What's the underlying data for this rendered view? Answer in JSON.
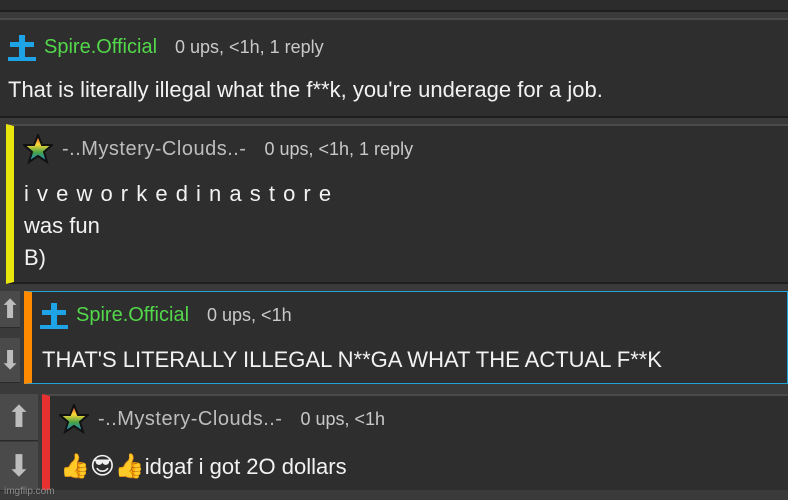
{
  "colors": {
    "username_green": "#52d84a",
    "thread_yellow": "#e8e60b",
    "thread_orange": "#ff8a00",
    "thread_red": "#e83030",
    "highlight_blue": "#1fa3d8"
  },
  "comments": [
    {
      "user": "Spire.Official",
      "meta": "0 ups, <1h, 1 reply",
      "text": "That is literally illegal what the f**k, you're underage for a job."
    },
    {
      "user": "-..Mystery-Clouds..-",
      "meta": "0 ups, <1h, 1 reply",
      "lines": [
        "i v e w o r k e d i n a s t o r e",
        "was fun",
        "B)"
      ]
    },
    {
      "user": "Spire.Official",
      "meta": "0 ups, <1h",
      "text": "THAT'S LITERALLY ILLEGAL N**GA WHAT THE ACTUAL F**K"
    },
    {
      "user": "-..Mystery-Clouds..-",
      "meta": "0 ups, <1h",
      "emoji": "👍😎👍",
      "text": "idgaf i got 2O dollars"
    }
  ],
  "icons": {
    "vote_up": "up-arrow-icon",
    "vote_down": "down-arrow-icon",
    "spire_avatar": "cross-icon",
    "mystery_avatar": "rainbow-star-icon"
  },
  "watermark": "imgflip.com"
}
